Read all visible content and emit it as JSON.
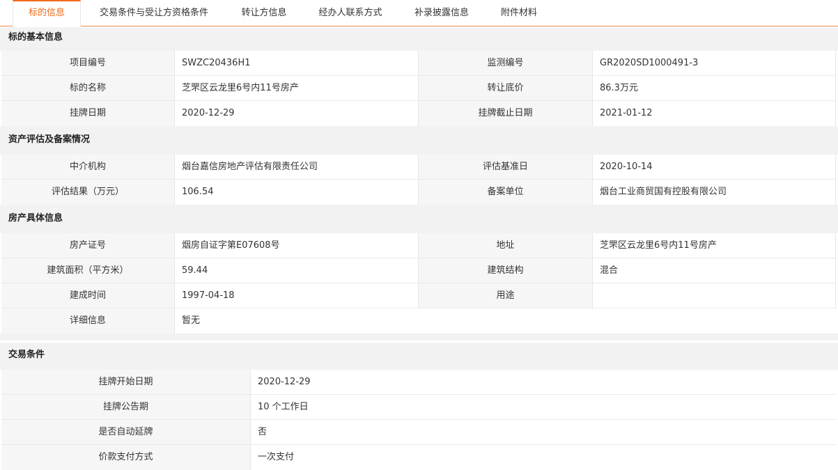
{
  "tabs": [
    "标的信息",
    "交易条件与受让方资格条件",
    "转让方信息",
    "经办人联系方式",
    "补录披露信息",
    "附件材料"
  ],
  "sections": {
    "basic": {
      "title": "标的基本信息",
      "rows": [
        {
          "l1": "项目编号",
          "v1": "SWZC20436H1",
          "l2": "监测编号",
          "v2": "GR2020SD1000491-3"
        },
        {
          "l1": "标的名称",
          "v1": "芝罘区云龙里6号内11号房产",
          "l2": "转让底价",
          "v2": "86.3万元"
        },
        {
          "l1": "挂牌日期",
          "v1": "2020-12-29",
          "l2": "挂牌截止日期",
          "v2": "2021-01-12"
        }
      ]
    },
    "appraisal": {
      "title": "资产评估及备案情况",
      "rows": [
        {
          "l1": "中介机构",
          "v1": "烟台嘉信房地产评估有限责任公司",
          "l2": "评估基准日",
          "v2": "2020-10-14"
        },
        {
          "l1": "评估结果（万元）",
          "v1": "106.54",
          "l2": "备案单位",
          "v2": "烟台工业商贸国有控股有限公司"
        }
      ]
    },
    "property": {
      "title": "房产具体信息",
      "rows": [
        {
          "l1": "房产证号",
          "v1": "烟房自证字第E07608号",
          "l2": "地址",
          "v2": "芝罘区云龙里6号内11号房产"
        },
        {
          "l1": "建筑面积（平方米）",
          "v1": "59.44",
          "l2": "建筑结构",
          "v2": "混合"
        },
        {
          "l1": "建成时间",
          "v1": "1997-04-18",
          "l2": "用途",
          "v2": ""
        }
      ],
      "detail_label": "详细信息",
      "detail_value": "暂无"
    },
    "trade": {
      "title": "交易条件",
      "rows": [
        {
          "l": "挂牌开始日期",
          "v": "2020-12-29"
        },
        {
          "l": "挂牌公告期",
          "v": "10 个工作日"
        },
        {
          "l": "是否自动延牌",
          "v": "否"
        },
        {
          "l": "价款支付方式",
          "v": "一次支付"
        }
      ]
    }
  }
}
